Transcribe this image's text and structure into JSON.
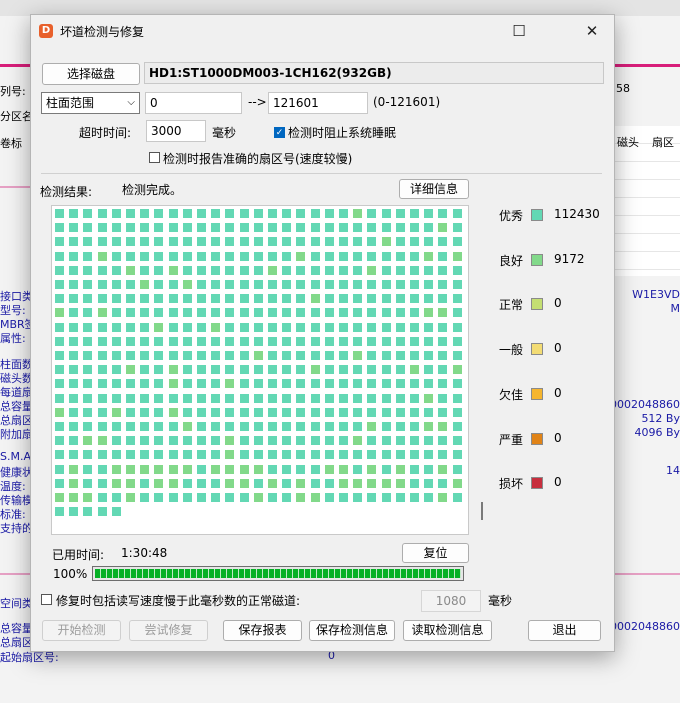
{
  "background": {
    "left_labels": [
      "列号:",
      "分区名",
      "卷标",
      "接口类",
      "型号:",
      "MBR签",
      "属性:",
      "柱面数",
      "磁头数",
      "每道扇",
      "总容量",
      "总扇区",
      "附加扇",
      "S.M.A",
      "健康状",
      "温度:",
      "传输模",
      "标准:",
      "支持的",
      "空间类",
      "总容量",
      "总扇区",
      "起始扇区号:"
    ],
    "right_labels": [
      "58",
      "磁头",
      "扇区",
      "W1E3VD",
      "M",
      "0002048860",
      "512 By",
      "4096 By",
      "14",
      "0002048860"
    ],
    "start_sector_value": "0"
  },
  "dialog": {
    "title": "坏道检测与修复",
    "select_disk_button": "选择磁盘",
    "disk_name": "HD1:ST1000DM003-1CH162(932GB)",
    "range_mode": "柱面范围",
    "range_start": "0",
    "range_arrow": "-->",
    "range_end": "121601",
    "range_hint": "(0-121601)",
    "timeout_label": "超时时间:",
    "timeout_value": "3000",
    "timeout_unit": "毫秒",
    "prevent_sleep_label": "检测时阻止系统睡眠",
    "prevent_sleep_checked": true,
    "report_sector_label": "检测时报告准确的扇区号(速度较慢)",
    "report_sector_checked": false,
    "result_label": "检测结果:",
    "result_text": "检测完成。",
    "details_button": "详细信息",
    "elapsed_label": "已用时间:",
    "elapsed_value": "1:30:48",
    "reset_button": "复位",
    "progress_text": "100%",
    "progress_fraction": 1.0,
    "repair_slow_label": "修复时包括读写速度慢于此毫秒数的正常磁道:",
    "repair_slow_checked": false,
    "repair_slow_value": "1080",
    "repair_slow_unit": "毫秒",
    "buttons": {
      "start": "开始检测",
      "try_repair": "尝试修复",
      "save_report": "保存报表",
      "save_info": "保存检测信息",
      "read_info": "读取检测信息",
      "exit": "退出"
    }
  },
  "legend": [
    {
      "label": "优秀",
      "count": "112430",
      "color": "#63d8b4"
    },
    {
      "label": "良好",
      "count": "9172",
      "color": "#82d98a"
    },
    {
      "label": "正常",
      "count": "0",
      "color": "#c4df72"
    },
    {
      "label": "一般",
      "count": "0",
      "color": "#f3dc74"
    },
    {
      "label": "欠佳",
      "count": "0",
      "color": "#f5b52e"
    },
    {
      "label": "严重",
      "count": "0",
      "color": "#e08317"
    },
    {
      "label": "损坏",
      "count": "0",
      "color": "#c72e3d"
    }
  ],
  "chart_data": {
    "type": "heatmap",
    "categories": [
      "优秀",
      "良好",
      "正常",
      "一般",
      "欠佳",
      "严重",
      "损坏"
    ],
    "values": [
      112430,
      9172,
      0,
      0,
      0,
      0,
      0
    ]
  }
}
